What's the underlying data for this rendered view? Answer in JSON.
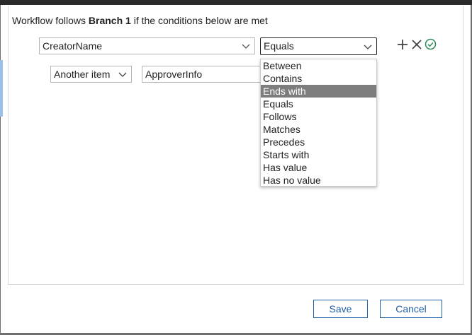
{
  "header": {
    "prefix": "Workflow follows",
    "branch": "Branch 1",
    "suffix": "if the conditions below are met"
  },
  "condition": {
    "field_value": "CreatorName",
    "operator_value": "Equals",
    "source_value": "Another item",
    "target_value": "ApproverInfo"
  },
  "operator_options": [
    "Between",
    "Contains",
    "Ends with",
    "Equals",
    "Follows",
    "Matches",
    "Precedes",
    "Starts with",
    "Has value",
    "Has no value"
  ],
  "highlighted_option": "Ends with",
  "actions": {
    "add_icon": "plus-icon",
    "remove_icon": "close-icon",
    "confirm_icon": "check-circle-icon"
  },
  "footer": {
    "save_label": "Save",
    "cancel_label": "Cancel"
  },
  "colors": {
    "accent": "#1f5fa8",
    "highlight": "#7d7d7d",
    "confirm": "#2e8b57"
  }
}
